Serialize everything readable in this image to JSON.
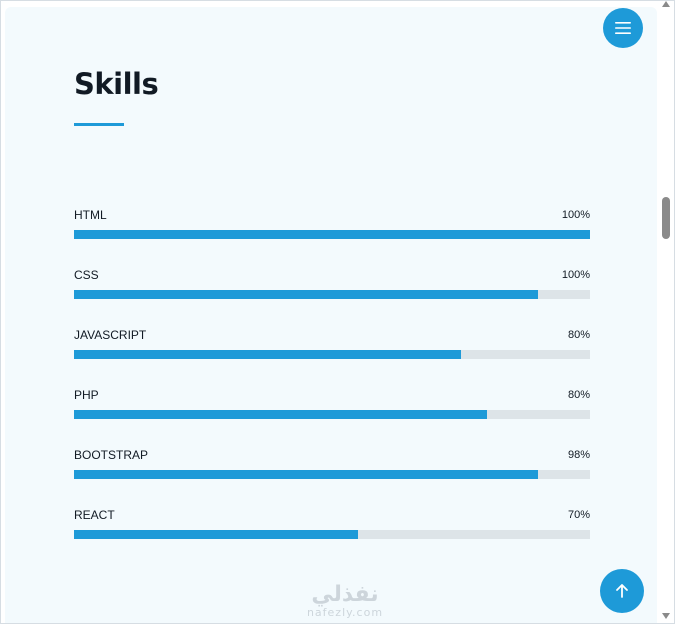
{
  "section": {
    "title": "Skills"
  },
  "skills": [
    {
      "name": "HTML",
      "percent_label": "100%",
      "fill_fraction": 1.0
    },
    {
      "name": "CSS",
      "percent_label": "100%",
      "fill_fraction": 0.9
    },
    {
      "name": "JAVASCRIPT",
      "percent_label": "80%",
      "fill_fraction": 0.75
    },
    {
      "name": "PHP",
      "percent_label": "80%",
      "fill_fraction": 0.8
    },
    {
      "name": "BOOTSTRAP",
      "percent_label": "98%",
      "fill_fraction": 0.9
    },
    {
      "name": "REACT",
      "percent_label": "70%",
      "fill_fraction": 0.55
    }
  ],
  "icons": {
    "menu": "hamburger-menu-icon",
    "back_to_top": "arrow-up-icon"
  },
  "watermark": {
    "arabic": "نفذلي",
    "latin": "nafezly.com"
  },
  "colors": {
    "accent": "#1e9ad8",
    "track": "#dde4e8",
    "background": "#f3fafd",
    "text": "#111a24"
  }
}
